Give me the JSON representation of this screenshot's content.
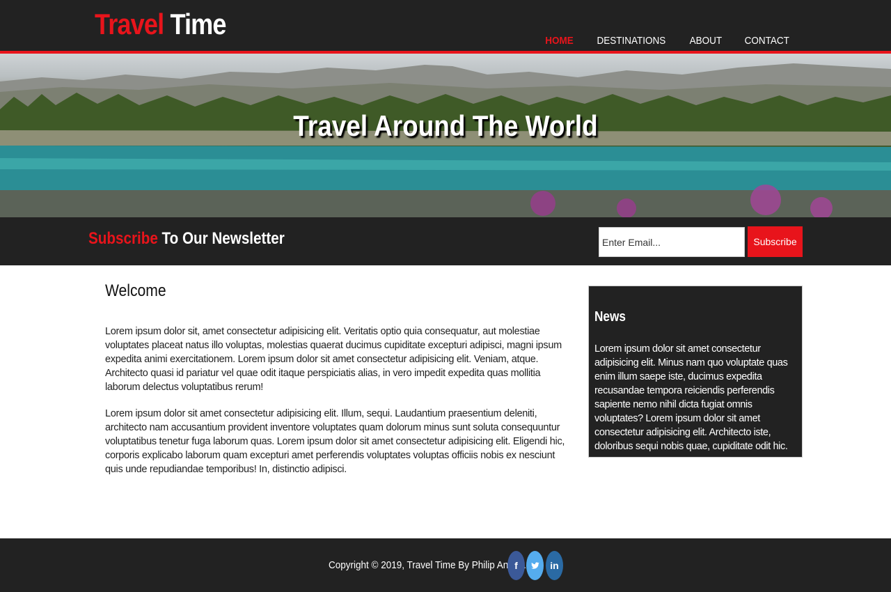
{
  "header": {
    "logo_accent": "Travel",
    "logo_rest": "Time",
    "nav": [
      {
        "label": "HOME",
        "active": true
      },
      {
        "label": "DESTINATIONS",
        "active": false
      },
      {
        "label": "ABOUT",
        "active": false
      },
      {
        "label": "CONTACT",
        "active": false
      }
    ]
  },
  "hero": {
    "title": "Travel Around The World"
  },
  "newsletter": {
    "heading_accent": "Subscribe",
    "heading_rest": "To Our Newsletter",
    "email_placeholder": "Enter Email...",
    "email_value": "",
    "button_label": "Subscribe"
  },
  "main": {
    "title": "Welcome",
    "paragraphs": [
      "Lorem ipsum dolor sit, amet consectetur adipisicing elit. Veritatis optio quia consequatur, aut molestiae voluptates placeat natus illo voluptas, molestias quaerat ducimus cupiditate excepturi adipisci, magni ipsum expedita animi exercitationem. Lorem ipsum dolor sit amet consectetur adipisicing elit. Veniam, atque. Architecto quasi id pariatur vel quae odit itaque perspiciatis alias, in vero impedit expedita quas mollitia laborum delectus voluptatibus rerum!",
      "Lorem ipsum dolor sit amet consectetur adipisicing elit. Illum, sequi. Laudantium praesentium deleniti, architecto nam accusantium provident inventore voluptates quam dolorum minus sunt soluta consequuntur voluptatibus tenetur fuga laborum quas. Lorem ipsum dolor sit amet consectetur adipisicing elit. Eligendi hic, corporis explicabo laborum quam excepturi amet perferendis voluptates voluptas officiis nobis ex nesciunt quis unde repudiandae temporibus! In, distinctio adipisci."
    ]
  },
  "sidebar": {
    "title": "News",
    "body": "Lorem ipsum dolor sit amet consectetur adipisicing elit. Minus nam quo voluptate quas enim illum saepe iste, ducimus expedita recusandae tempora reiciendis perferendis sapiente nemo nihil dicta fugiat omnis voluptates? Lorem ipsum dolor sit amet consectetur adipisicing elit. Architecto iste, doloribus sequi nobis quae, cupiditate odit hic."
  },
  "footer": {
    "copyright": "Copyright © 2019, Travel Time By Philip Andes.",
    "social": [
      {
        "icon": "facebook-icon",
        "glyph": "f"
      },
      {
        "icon": "twitter-icon",
        "glyph": "t"
      },
      {
        "icon": "linkedin-icon",
        "glyph": "in"
      }
    ]
  },
  "colors": {
    "accent": "#e8141b",
    "dark": "#222222"
  }
}
